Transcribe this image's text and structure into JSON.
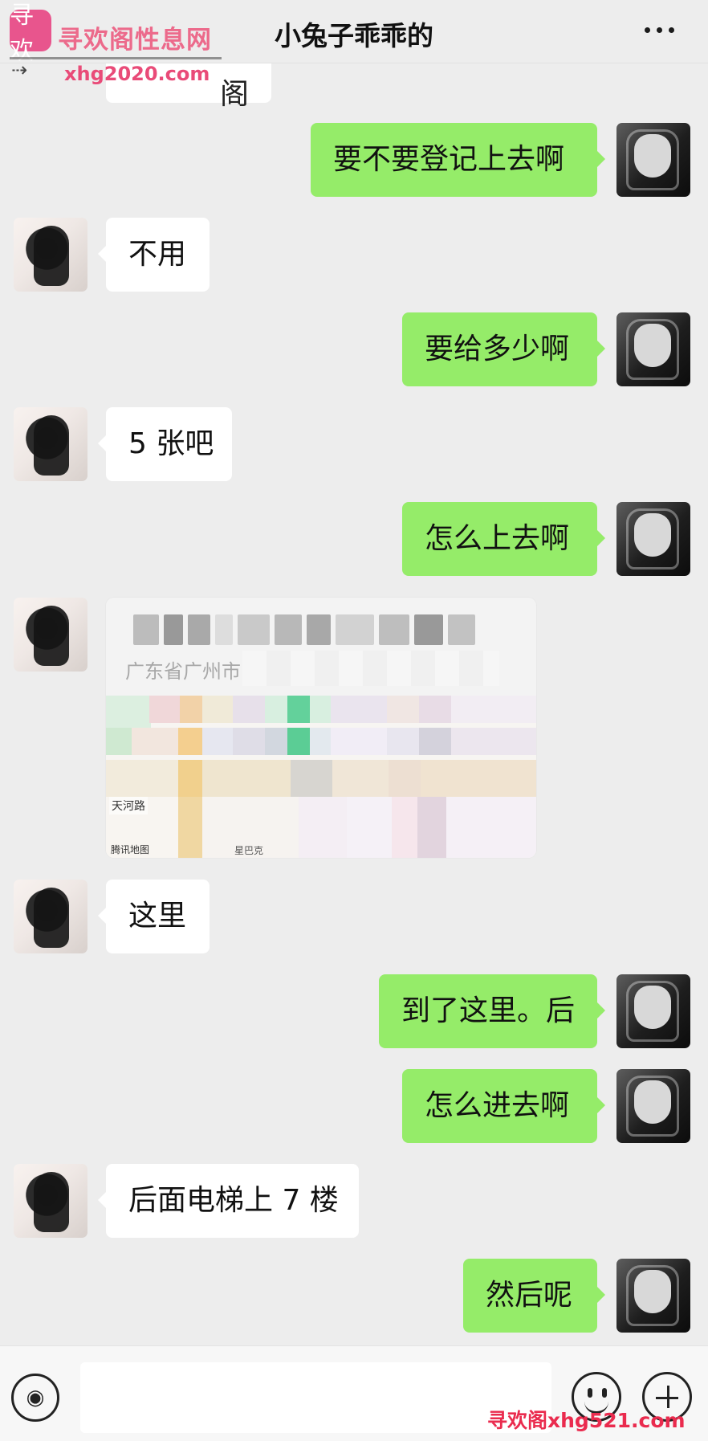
{
  "header": {
    "title": "小兔子乖乖的"
  },
  "watermark": {
    "logo_text": "寻欢",
    "site_name": "寻欢阁性息网",
    "site_url": "xhg2020.com",
    "bottom_text": "寻欢阁xhg521.com"
  },
  "messages": [
    {
      "side": "right",
      "text": "要不要登记上去啊"
    },
    {
      "side": "left",
      "text": "不用"
    },
    {
      "side": "right",
      "text": "要给多少啊"
    },
    {
      "side": "left",
      "text": "5 张吧"
    },
    {
      "side": "right",
      "text": "怎么上去啊"
    },
    {
      "side": "left",
      "text": "这里"
    },
    {
      "side": "right",
      "text": "到了这里。后"
    },
    {
      "side": "right",
      "text": "怎么进去啊"
    },
    {
      "side": "left",
      "text": "后面电梯上 7 楼"
    },
    {
      "side": "right",
      "text": "然后呢"
    }
  ],
  "partial_message": {
    "text": "阁"
  },
  "location": {
    "address": "广东省广州市",
    "map_label": "天河路",
    "map_source": "腾讯地图",
    "poi_label": "星巴克"
  },
  "input": {
    "placeholder": ""
  }
}
